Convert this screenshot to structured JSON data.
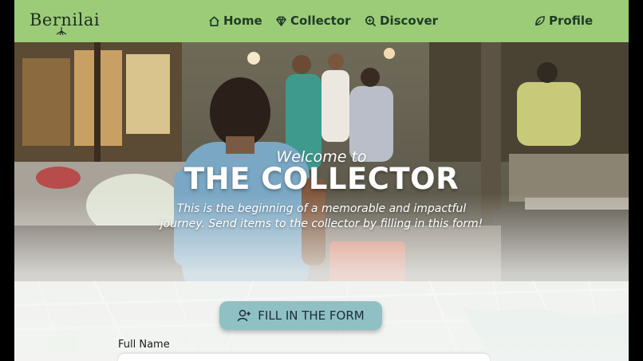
{
  "brand": {
    "name": "Bernilai"
  },
  "nav": {
    "items": [
      {
        "label": "Home",
        "icon": "home-icon"
      },
      {
        "label": "Collector",
        "icon": "diamond-icon"
      },
      {
        "label": "Discover",
        "icon": "search-icon"
      },
      {
        "label": "Profile",
        "icon": "leaf-icon"
      }
    ]
  },
  "hero": {
    "welcome": "Welcome to",
    "title": "THE COLLECTOR",
    "subtitle": "This is the beginning of a memorable and impactful journey. Send items to the collector by filling in this form!",
    "cta_label": "FILL IN THE FORM",
    "cta_icon": "user-add-icon"
  },
  "form": {
    "full_name_label": "Full Name",
    "full_name_value": ""
  },
  "colors": {
    "navbar": "#9ccc78",
    "nav_text": "#1f3b27",
    "cta": "#8fc0c4",
    "page_border": "#000000"
  }
}
